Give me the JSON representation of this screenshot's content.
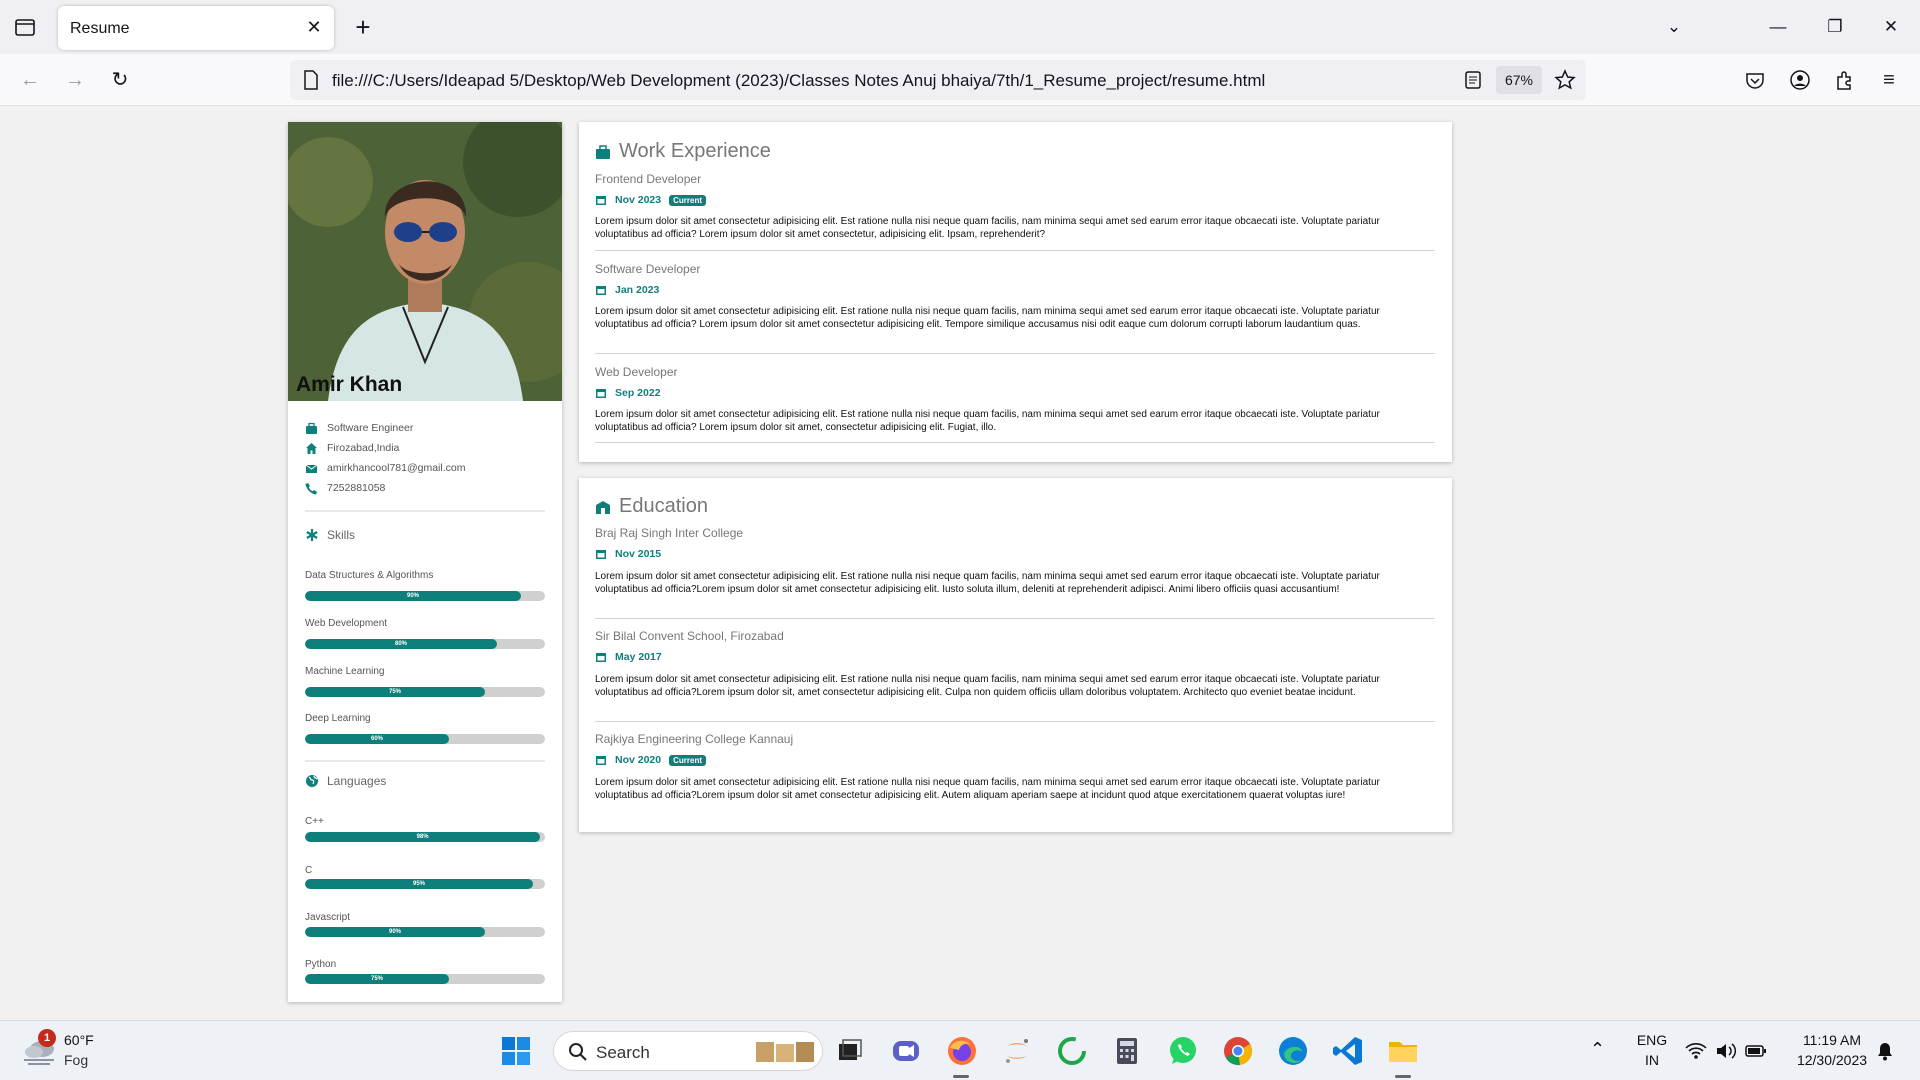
{
  "browser": {
    "tab_title": "Resume",
    "url": "file:///C:/Users/Ideapad 5/Desktop/Web Development (2023)/Classes Notes Anuj bhaiya/7th/1_Resume_project/resume.html",
    "zoom": "67%"
  },
  "profile": {
    "name": "Amir Khan",
    "info": [
      {
        "icon": "briefcase-icon",
        "text": "Software Engineer"
      },
      {
        "icon": "home-icon",
        "text": "Firozabad,India"
      },
      {
        "icon": "email-icon",
        "text": "amirkhancool781@gmail.com"
      },
      {
        "icon": "phone-icon",
        "text": "7252881058"
      }
    ]
  },
  "skills": {
    "heading": "Skills",
    "items": [
      {
        "label": "Data Structures & Algorithms",
        "value": 90,
        "text": "90%"
      },
      {
        "label": "Web Development",
        "value": 80,
        "text": "80%"
      },
      {
        "label": "Machine Learning",
        "value": 75,
        "text": "75%"
      },
      {
        "label": "Deep Learning",
        "value": 60,
        "text": "60%"
      }
    ]
  },
  "languages": {
    "heading": "Languages",
    "items": [
      {
        "label": "C++",
        "value": 98,
        "text": "98%"
      },
      {
        "label": "C",
        "value": 95,
        "text": "95%"
      },
      {
        "label": "Javascript",
        "value": 75,
        "text": "90%"
      },
      {
        "label": "Python",
        "value": 60,
        "text": "75%"
      }
    ]
  },
  "work": {
    "heading": "Work Experience",
    "entries": [
      {
        "title": "Frontend Developer",
        "date": "Nov 2023",
        "badge": "Current",
        "desc": "Lorem ipsum dolor sit amet consectetur adipisicing elit. Est ratione nulla nisi neque quam facilis, nam minima sequi amet sed earum error itaque obcaecati iste. Voluptate pariatur voluptatibus ad officia? Lorem ipsum dolor sit amet consectetur, adipisicing elit. Ipsam, reprehenderit?"
      },
      {
        "title": "Software Developer",
        "date": "Jan 2023",
        "badge": "",
        "desc": "Lorem ipsum dolor sit amet consectetur adipisicing elit. Est ratione nulla nisi neque quam facilis, nam minima sequi amet sed earum error itaque obcaecati iste. Voluptate pariatur voluptatibus ad officia? Lorem ipsum dolor sit amet consectetur adipisicing elit. Tempore similique accusamus nisi odit eaque cum dolorum corrupti laborum laudantium quas."
      },
      {
        "title": "Web Developer",
        "date": "Sep 2022",
        "badge": "",
        "desc": "Lorem ipsum dolor sit amet consectetur adipisicing elit. Est ratione nulla nisi neque quam facilis, nam minima sequi amet sed earum error itaque obcaecati iste. Voluptate pariatur voluptatibus ad officia? Lorem ipsum dolor sit amet, consectetur adipisicing elit. Fugiat, illo."
      }
    ]
  },
  "education": {
    "heading": "Education",
    "entries": [
      {
        "title": "Braj Raj Singh Inter College",
        "date": "Nov 2015",
        "badge": "",
        "desc": "Lorem ipsum dolor sit amet consectetur adipisicing elit. Est ratione nulla nisi neque quam facilis, nam minima sequi amet sed earum error itaque obcaecati iste. Voluptate pariatur voluptatibus ad officia?Lorem ipsum dolor sit amet consectetur adipisicing elit. Iusto soluta illum, deleniti at reprehenderit adipisci. Animi libero officiis quasi accusantium!"
      },
      {
        "title": "Sir Bilal Convent School, Firozabad",
        "date": "May 2017",
        "badge": "",
        "desc": "Lorem ipsum dolor sit amet consectetur adipisicing elit. Est ratione nulla nisi neque quam facilis, nam minima sequi amet sed earum error itaque obcaecati iste. Voluptate pariatur voluptatibus ad officia?Lorem ipsum dolor sit, amet consectetur adipisicing elit. Culpa non quidem officiis ullam doloribus voluptatem. Architecto quo eveniet beatae incidunt."
      },
      {
        "title": "Rajkiya Engineering College Kannauj",
        "date": "Nov 2020",
        "badge": "Current",
        "desc": "Lorem ipsum dolor sit amet consectetur adipisicing elit. Est ratione nulla nisi neque quam facilis, nam minima sequi amet sed earum error itaque obcaecati iste. Voluptate pariatur voluptatibus ad officia?Lorem ipsum dolor sit amet consectetur adipisicing elit. Autem aliquam aperiam saepe at incidunt quod atque exercitationem quaerat voluptas iure!"
      }
    ]
  },
  "taskbar": {
    "weather_badge": "1",
    "temperature": "60°F",
    "condition": "Fog",
    "search_placeholder": "Search",
    "language": "ENG",
    "region": "IN",
    "time": "11:19 AM",
    "date": "12/30/2023"
  },
  "colors": {
    "accent": "#0f7f7c",
    "bar_track": "#d0d0d0"
  }
}
